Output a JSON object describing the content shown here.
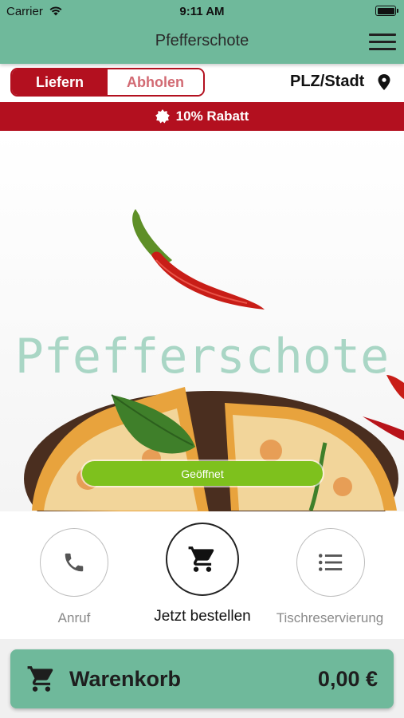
{
  "status_bar": {
    "carrier": "Carrier",
    "time": "9:11 AM"
  },
  "header": {
    "title": "Pfefferschote",
    "menu_icon": "hamburger-menu-icon"
  },
  "order_mode": {
    "options": [
      "Liefern",
      "Abholen"
    ],
    "selected": "Liefern"
  },
  "location": {
    "label": "PLZ/Stadt",
    "icon": "location-pin-icon"
  },
  "discount": {
    "label": "10% Rabatt",
    "icon": "badge-icon"
  },
  "hero": {
    "brand": "Pfefferschote",
    "status": "Geöffnet"
  },
  "actions": [
    {
      "label": "Anruf",
      "icon": "phone-icon"
    },
    {
      "label": "Jetzt bestellen",
      "icon": "cart-icon"
    },
    {
      "label": "Tischreservierung",
      "icon": "list-icon"
    }
  ],
  "cart": {
    "label": "Warenkorb",
    "total": "0,00 €",
    "icon": "cart-icon"
  },
  "colors": {
    "header": "#6fb99b",
    "accent": "#b3101f",
    "open": "#7ec11d",
    "brand_text": "#a9d6c5"
  }
}
